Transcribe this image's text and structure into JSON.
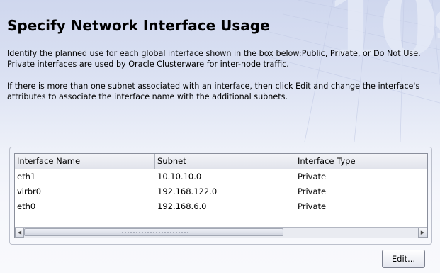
{
  "branding": {
    "logo_main": "10",
    "logo_sup": "g"
  },
  "header": {
    "title": "Specify Network Interface Usage"
  },
  "instructions": {
    "para1": "Identify the planned use for each global interface shown in the box below:Public, Private, or Do Not Use.  Private interfaces are used by Oracle Clusterware for inter-node traffic.",
    "para2": "If there is more than one subnet associated with an interface, then click Edit and change the interface's attributes to associate the interface name with the additional subnets."
  },
  "table": {
    "columns": [
      "Interface Name",
      "Subnet",
      "Interface Type"
    ],
    "rows": [
      {
        "name": "eth1",
        "subnet": "10.10.10.0",
        "type": "Private"
      },
      {
        "name": "virbr0",
        "subnet": "192.168.122.0",
        "type": "Private"
      },
      {
        "name": "eth0",
        "subnet": "192.168.6.0",
        "type": "Private"
      }
    ],
    "scroll_left_icon": "arrow-left",
    "scroll_right_icon": "arrow-right"
  },
  "buttons": {
    "edit_label": "Edit..."
  }
}
